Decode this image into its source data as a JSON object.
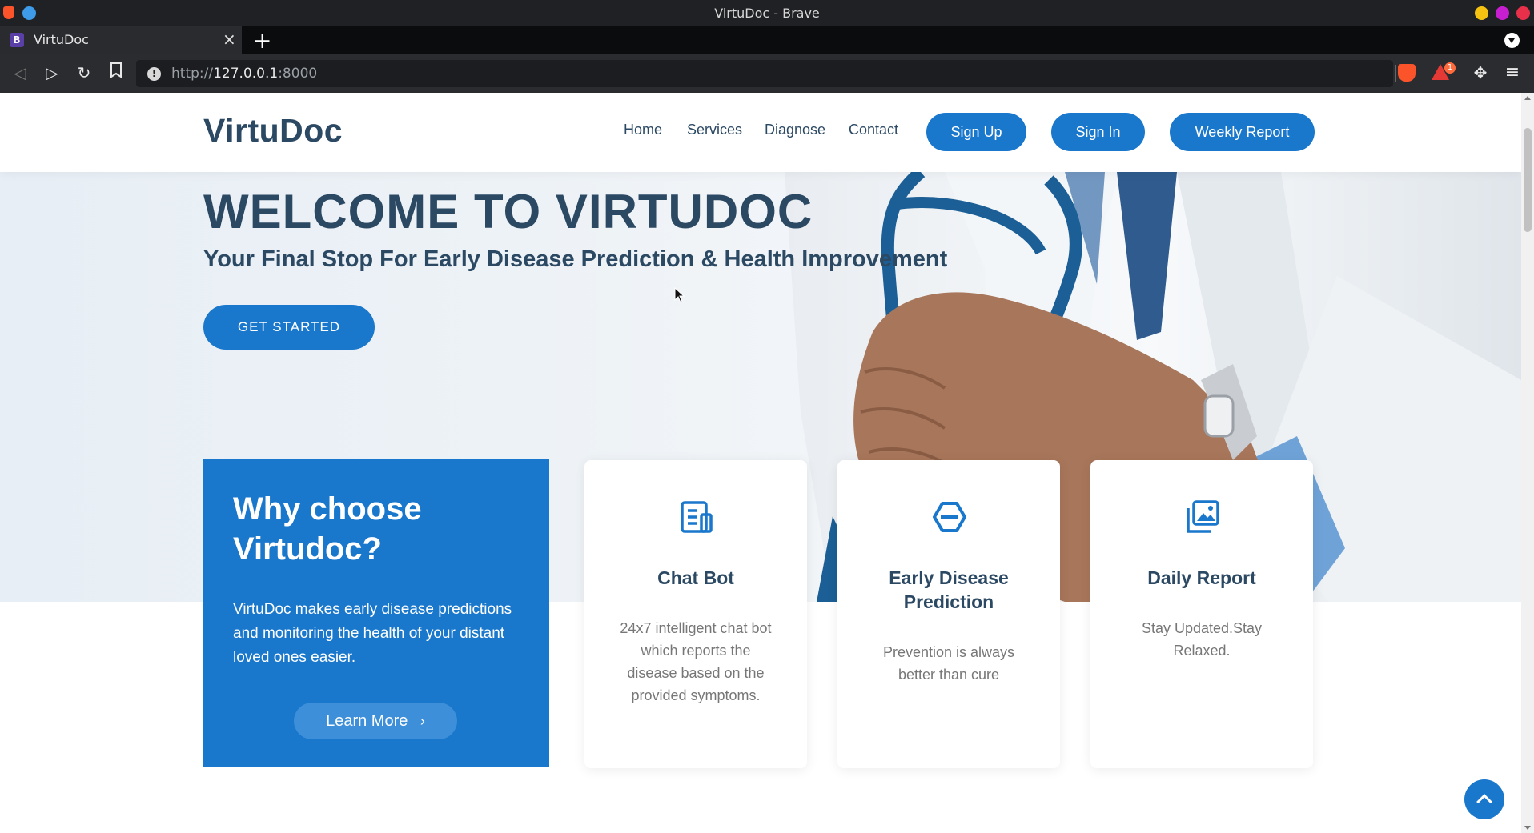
{
  "browser": {
    "window_title": "VirtuDoc - Brave",
    "tab": {
      "favicon": "B",
      "title": "VirtuDoc"
    },
    "url": {
      "scheme": "http://",
      "host": "127.0.0.1",
      "port": ":8000"
    },
    "extension_badge": "1"
  },
  "header": {
    "logo": "VirtuDoc",
    "nav": [
      "Home",
      "Services",
      "Diagnose",
      "Contact"
    ],
    "buttons": [
      "Sign Up",
      "Sign In",
      "Weekly Report"
    ]
  },
  "hero": {
    "title": "WELCOME TO VIRTUDOC",
    "subtitle": "Your Final Stop For Early Disease Prediction & Health Improvement",
    "cta": "GET STARTED"
  },
  "why": {
    "title": "Why choose Virtudoc?",
    "body": "VirtuDoc makes early disease predictions and monitoring the health of your distant loved ones easier.",
    "button": "Learn More",
    "button_icon": "›"
  },
  "cards": [
    {
      "icon": "document-icon",
      "title": "Chat Bot",
      "text": "24x7 intelligent chat bot which reports the disease based on the provided symptoms."
    },
    {
      "icon": "hexagon-icon",
      "title": "Early Disease Prediction",
      "text": "Prevention is always better than cure"
    },
    {
      "icon": "images-icon",
      "title": "Daily Report",
      "text": "Stay Updated.Stay Relaxed."
    }
  ],
  "colors": {
    "primary": "#1977cc",
    "heading": "#2c4964",
    "muted": "#777777"
  }
}
